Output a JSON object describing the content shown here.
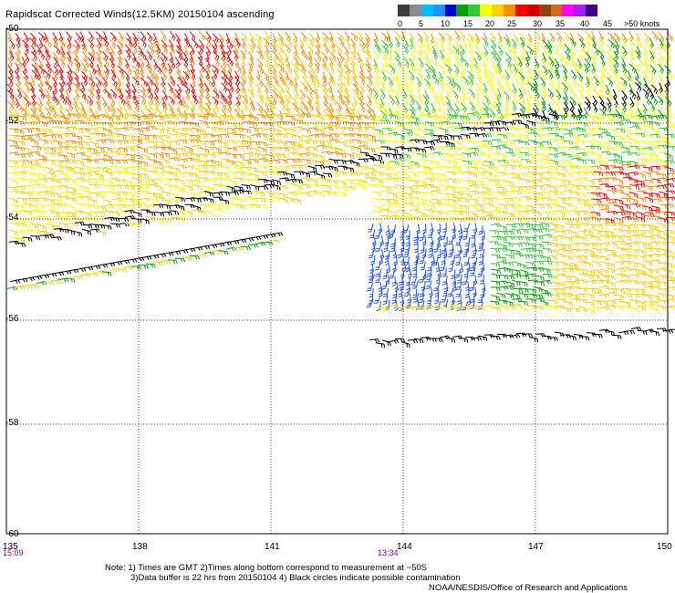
{
  "title": "Rapidscat Corrected Winds(12.5KM) 20150104 ascending",
  "scale": {
    "colors": [
      "#3c3c3c",
      "#8c8c8c",
      "#00bfff",
      "#1e90ff",
      "#0000d0",
      "#00a000",
      "#34c834",
      "#ffff00",
      "#ffd000",
      "#ff8c00",
      "#ff0000",
      "#d00000",
      "#8b4513",
      "#d2691e",
      "#ff00ff",
      "#a020f0",
      "#3c0080"
    ],
    "labels": [
      "0",
      "5",
      "10",
      "15",
      "20",
      "25",
      "30",
      "35",
      "40",
      "45",
      ">50 knots"
    ]
  },
  "lat_labels": [
    "-50",
    "-52",
    "-54",
    "-56",
    "-58",
    "-60"
  ],
  "lon_labels": [
    "135",
    "138",
    "141",
    "144",
    "147",
    "150"
  ],
  "times": [
    "15:09",
    "13:34"
  ],
  "notes": {
    "line1": "Note: 1) Times are GMT 2)Times along bottom correspond to measurement at ~50S",
    "line2": "3)Data buffer is 22 hrs from 20150104 4) Black circles indicate possible contamination",
    "line3": "NOAA/NESDIS/Office of Research and Applications"
  }
}
